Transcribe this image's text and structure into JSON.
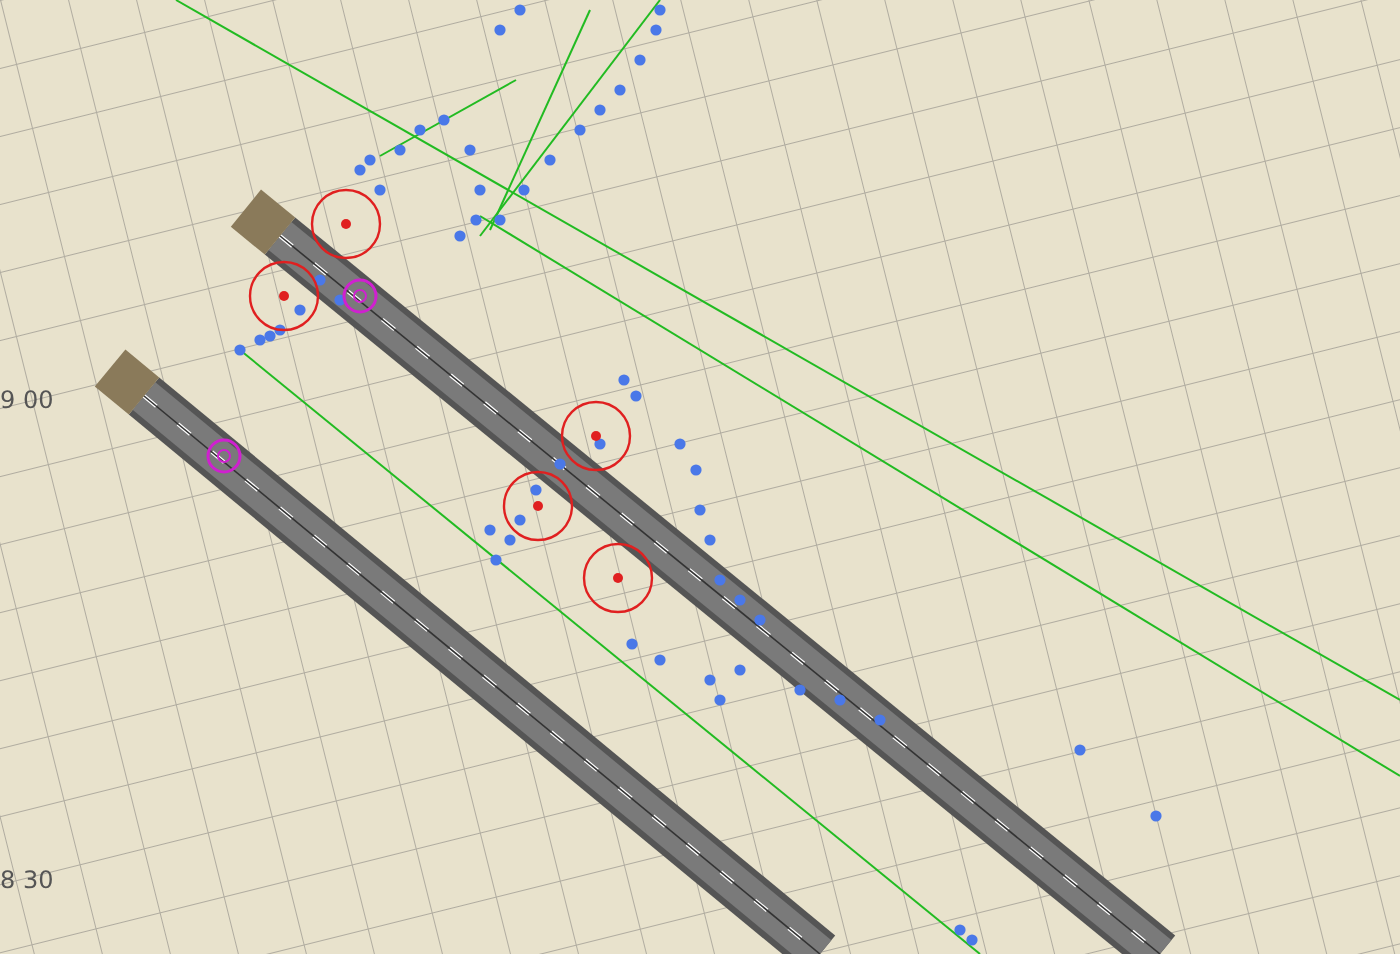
{
  "canvas": {
    "grid_labels": [
      "9 00",
      "8 30"
    ]
  }
}
